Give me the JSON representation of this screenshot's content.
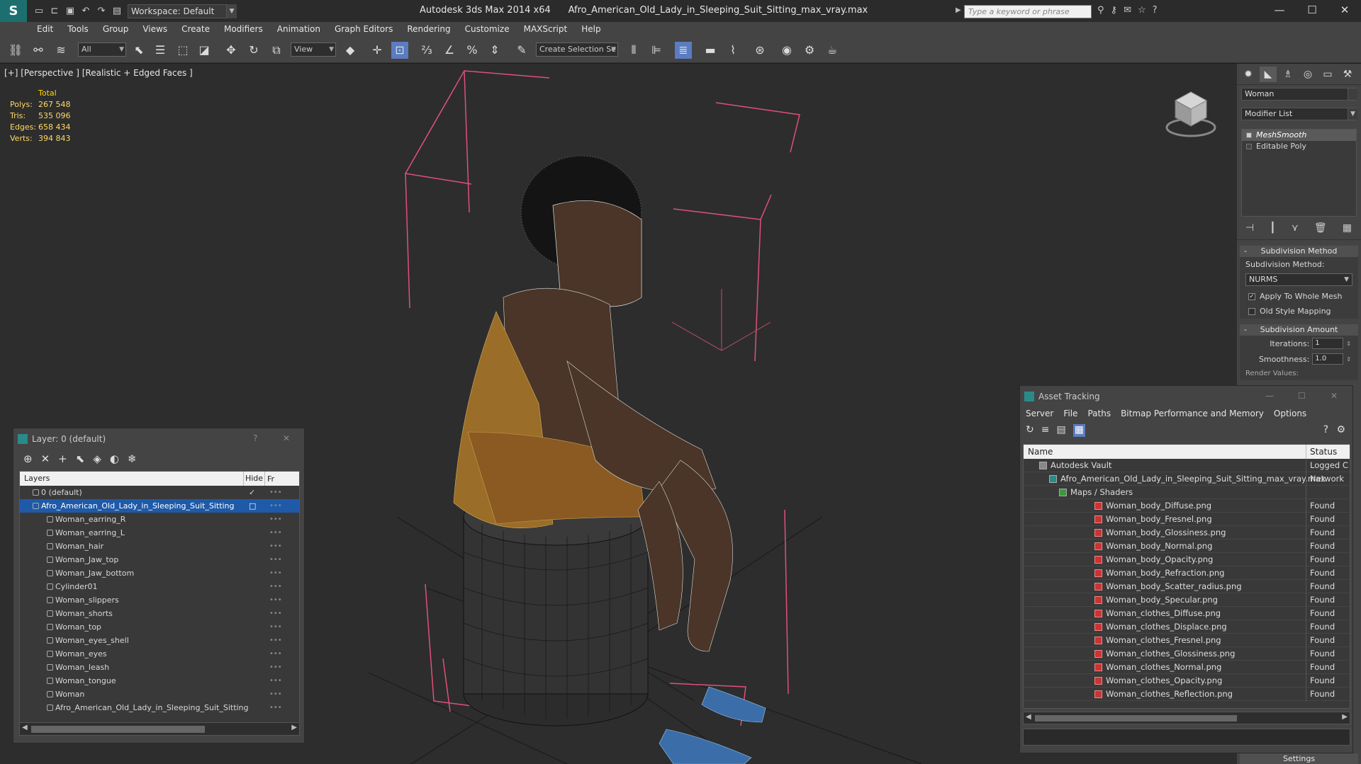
{
  "window": {
    "workspace": "Workspace: Default",
    "app_title": "Autodesk 3ds Max  2014 x64",
    "file_title": "Afro_American_Old_Lady_in_Sleeping_Suit_Sitting_max_vray.max",
    "search_placeholder": "Type a keyword or phrase"
  },
  "menu": [
    "Edit",
    "Tools",
    "Group",
    "Views",
    "Create",
    "Modifiers",
    "Animation",
    "Graph Editors",
    "Rendering",
    "Customize",
    "MAXScript",
    "Help"
  ],
  "toolbar": {
    "selection_filter": "All",
    "reference_coord": "View",
    "named_selection": "Create Selection Se"
  },
  "viewport": {
    "label": "[+] [Perspective ] [Realistic + Edged Faces ]",
    "stats_header": "Total",
    "stats": [
      {
        "label": "Polys:",
        "value": "267 548"
      },
      {
        "label": "Tris:",
        "value": "535 096"
      },
      {
        "label": "Edges:",
        "value": "658 434"
      },
      {
        "label": "Verts:",
        "value": "394 843"
      }
    ]
  },
  "command_panel": {
    "object_name": "Woman",
    "modifier_list": "Modifier List",
    "stack": [
      "MeshSmooth",
      "Editable Poly"
    ],
    "subdivision_method_title": "Subdivision Method",
    "subdivision_method_label": "Subdivision Method:",
    "subdivision_method_value": "NURMS",
    "apply_whole_mesh": "Apply To Whole Mesh",
    "old_style_mapping": "Old Style Mapping",
    "subdivision_amount_title": "Subdivision Amount",
    "iterations_label": "Iterations:",
    "iterations_value": "1",
    "smoothness_label": "Smoothness:",
    "smoothness_value": "1.0",
    "render_values": "Render Values:",
    "settings": "Settings"
  },
  "layer_dialog": {
    "title": "Layer: 0 (default)",
    "col_layers": "Layers",
    "col_hide": "Hide",
    "col_fr": "Fr",
    "rows": [
      {
        "name": "0 (default)",
        "level": "top",
        "hide": "✓"
      },
      {
        "name": "Afro_American_Old_Lady_in_Sleeping_Suit_Sitting",
        "level": "top",
        "selected": true,
        "hide": "□"
      },
      {
        "name": "Woman_earring_R",
        "level": "child"
      },
      {
        "name": "Woman_earring_L",
        "level": "child"
      },
      {
        "name": "Woman_hair",
        "level": "child"
      },
      {
        "name": "Woman_Jaw_top",
        "level": "child"
      },
      {
        "name": "Woman_Jaw_bottom",
        "level": "child"
      },
      {
        "name": "Cylinder01",
        "level": "child"
      },
      {
        "name": "Woman_slippers",
        "level": "child"
      },
      {
        "name": "Woman_shorts",
        "level": "child"
      },
      {
        "name": "Woman_top",
        "level": "child"
      },
      {
        "name": "Woman_eyes_shell",
        "level": "child"
      },
      {
        "name": "Woman_eyes",
        "level": "child"
      },
      {
        "name": "Woman_leash",
        "level": "child"
      },
      {
        "name": "Woman_tongue",
        "level": "child"
      },
      {
        "name": "Woman",
        "level": "child"
      },
      {
        "name": "Afro_American_Old_Lady_in_Sleeping_Suit_Sitting",
        "level": "child"
      }
    ]
  },
  "asset_dialog": {
    "title": "Asset Tracking",
    "menu": [
      "Server",
      "File",
      "Paths",
      "Bitmap Performance and Memory",
      "Options"
    ],
    "col_name": "Name",
    "col_status": "Status",
    "rows": [
      {
        "name": "Autodesk Vault",
        "status": "Logged C",
        "indent": 0
      },
      {
        "name": "Afro_American_Old_Lady_in_Sleeping_Suit_Sitting_max_vray.max",
        "status": "Network",
        "indent": 1
      },
      {
        "name": "Maps / Shaders",
        "status": "",
        "indent": 2
      },
      {
        "name": "Woman_body_Diffuse.png",
        "status": "Found",
        "indent": 3
      },
      {
        "name": "Woman_body_Fresnel.png",
        "status": "Found",
        "indent": 3
      },
      {
        "name": "Woman_body_Glossiness.png",
        "status": "Found",
        "indent": 3
      },
      {
        "name": "Woman_body_Normal.png",
        "status": "Found",
        "indent": 3
      },
      {
        "name": "Woman_body_Opacity.png",
        "status": "Found",
        "indent": 3
      },
      {
        "name": "Woman_body_Refraction.png",
        "status": "Found",
        "indent": 3
      },
      {
        "name": "Woman_body_Scatter_radius.png",
        "status": "Found",
        "indent": 3
      },
      {
        "name": "Woman_body_Specular.png",
        "status": "Found",
        "indent": 3
      },
      {
        "name": "Woman_clothes_Diffuse.png",
        "status": "Found",
        "indent": 3
      },
      {
        "name": "Woman_clothes_Displace.png",
        "status": "Found",
        "indent": 3
      },
      {
        "name": "Woman_clothes_Fresnel.png",
        "status": "Found",
        "indent": 3
      },
      {
        "name": "Woman_clothes_Glossiness.png",
        "status": "Found",
        "indent": 3
      },
      {
        "name": "Woman_clothes_Normal.png",
        "status": "Found",
        "indent": 3
      },
      {
        "name": "Woman_clothes_Opacity.png",
        "status": "Found",
        "indent": 3
      },
      {
        "name": "Woman_clothes_Reflection.png",
        "status": "Found",
        "indent": 3
      }
    ]
  },
  "colors": {
    "selection": "#1e5aa8",
    "stats": "#ffd966",
    "bbox": "#e0507a"
  }
}
